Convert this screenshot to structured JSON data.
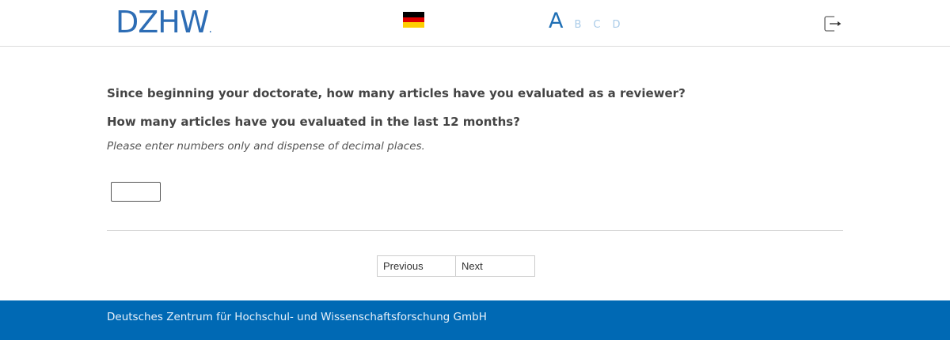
{
  "header": {
    "logo_text": "DZHW",
    "logo_dot": ".",
    "language_flag": "german-flag-icon",
    "font_sizes": [
      "A",
      "B",
      "C",
      "D"
    ],
    "logout_icon": "logout-icon",
    "colors": {
      "brand": "#2d6db5",
      "font_active": "#1f6fb5",
      "font_inactive": "#a9cbe8",
      "flag_black": "#000000",
      "flag_red": "#dd0000",
      "flag_gold": "#ffce00"
    }
  },
  "main": {
    "question_1": "Since beginning your doctorate, how many articles have you evaluated as a reviewer?",
    "question_2": "How many articles have you evaluated in the last 12 months?",
    "instruction": "Please enter numbers only and dispense of decimal places.",
    "input_value": ""
  },
  "navigation": {
    "previous_label": "Previous",
    "next_label": "Next"
  },
  "footer": {
    "text": "Deutsches Zentrum für Hochschul- und Wissenschaftsforschung GmbH",
    "color": "#0069b4"
  }
}
